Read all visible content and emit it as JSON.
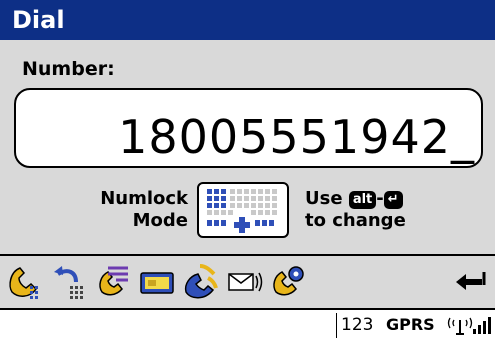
{
  "window": {
    "title": "Dial"
  },
  "number": {
    "label": "Number:",
    "value": "18005551942_"
  },
  "numlock": {
    "mode_line1": "Numlock",
    "mode_line2": "Mode",
    "use_text": "Use",
    "alt_key": "alt",
    "dash": "-",
    "change_text": "to change",
    "keyboard_icon": "numeric-keypad-icon"
  },
  "toolbar": {
    "buttons": [
      {
        "name": "dial-phone-icon"
      },
      {
        "name": "redial-icon"
      },
      {
        "name": "speed-dial-icon"
      },
      {
        "name": "sim-card-icon"
      },
      {
        "name": "call-log-icon"
      },
      {
        "name": "voicemail-icon"
      },
      {
        "name": "call-settings-icon"
      },
      {
        "name": "back-arrow-icon"
      }
    ]
  },
  "status": {
    "input_mode": "123",
    "network": "GPRS",
    "signal_icon": "signal-strength-icon"
  },
  "colors": {
    "titlebar": "#0d2f86",
    "panel": "#d9d9d9",
    "icon_yellow": "#e8b51a",
    "icon_blue": "#2f4fb8",
    "icon_purple": "#6d3bb0"
  }
}
